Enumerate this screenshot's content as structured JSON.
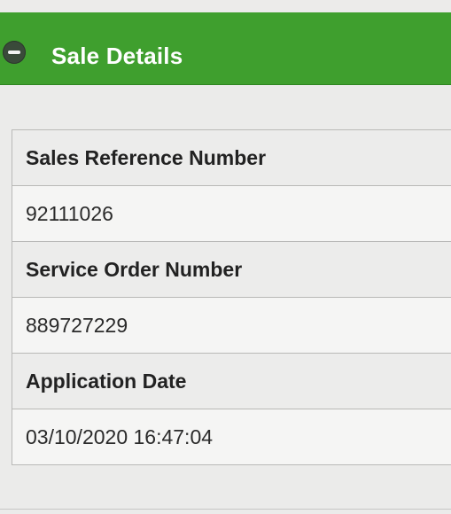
{
  "panel": {
    "title": "Sale Details",
    "toggle_icon": "minus-circle-icon",
    "header_color": "#3f9f2e"
  },
  "details": [
    {
      "label": "Sales Reference Number",
      "value": "92111026"
    },
    {
      "label": "Service Order Number",
      "value": "889727229"
    },
    {
      "label": "Application Date",
      "value": "03/10/2020 16:47:04"
    }
  ]
}
